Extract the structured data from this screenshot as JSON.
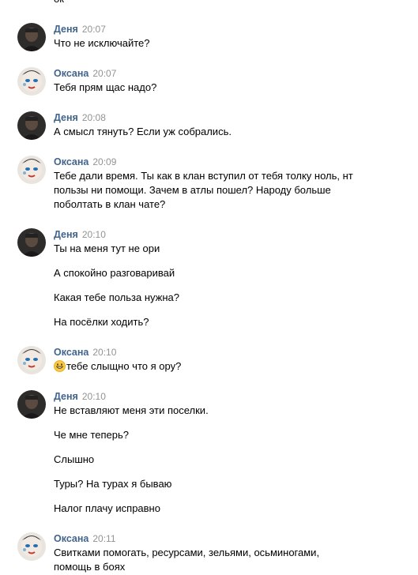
{
  "cut_top_text": "ок",
  "messages": [
    {
      "author": "Деня",
      "time": "20:07",
      "lines": [
        "Что не исключайте?"
      ]
    },
    {
      "author": "Оксана",
      "time": "20:07",
      "lines": [
        "Тебя прям щас надо?"
      ]
    },
    {
      "author": "Деня",
      "time": "20:08",
      "lines": [
        "А смысл тянуть? Если уж собрались."
      ]
    },
    {
      "author": "Оксана",
      "time": "20:09",
      "lines": [
        "Тебе дали время. Ты как в клан вступил от тебя толку ноль, нт",
        "пользы ни помощи. Зачем в атлы пошел? Народу больше",
        "поболтать в клан чате?"
      ]
    },
    {
      "author": "Деня",
      "time": "20:10",
      "lines": [
        "Ты на меня тут не ори",
        "А спокойно разговаривай",
        "Какая тебе польза нужна?",
        "На посёлки ходить?"
      ]
    },
    {
      "author": "Оксана",
      "time": "20:10",
      "lines": [
        "тебе слыщно что я ору?"
      ],
      "emoji": "grinning-face"
    },
    {
      "author": "Деня",
      "time": "20:10",
      "lines": [
        "Не вставляют меня эти поселки.",
        "Че мне теперь?",
        "Слышно",
        "Туры? На турах я бываю",
        "Налог плачу исправно"
      ]
    },
    {
      "author": "Оксана",
      "time": "20:11",
      "lines": [
        "Свитками помогать, ресурсами, зельями, осьминогами,",
        "помощь в боях"
      ]
    }
  ],
  "colors": {
    "author": "#42648b",
    "time": "#939393",
    "text": "#000000"
  }
}
